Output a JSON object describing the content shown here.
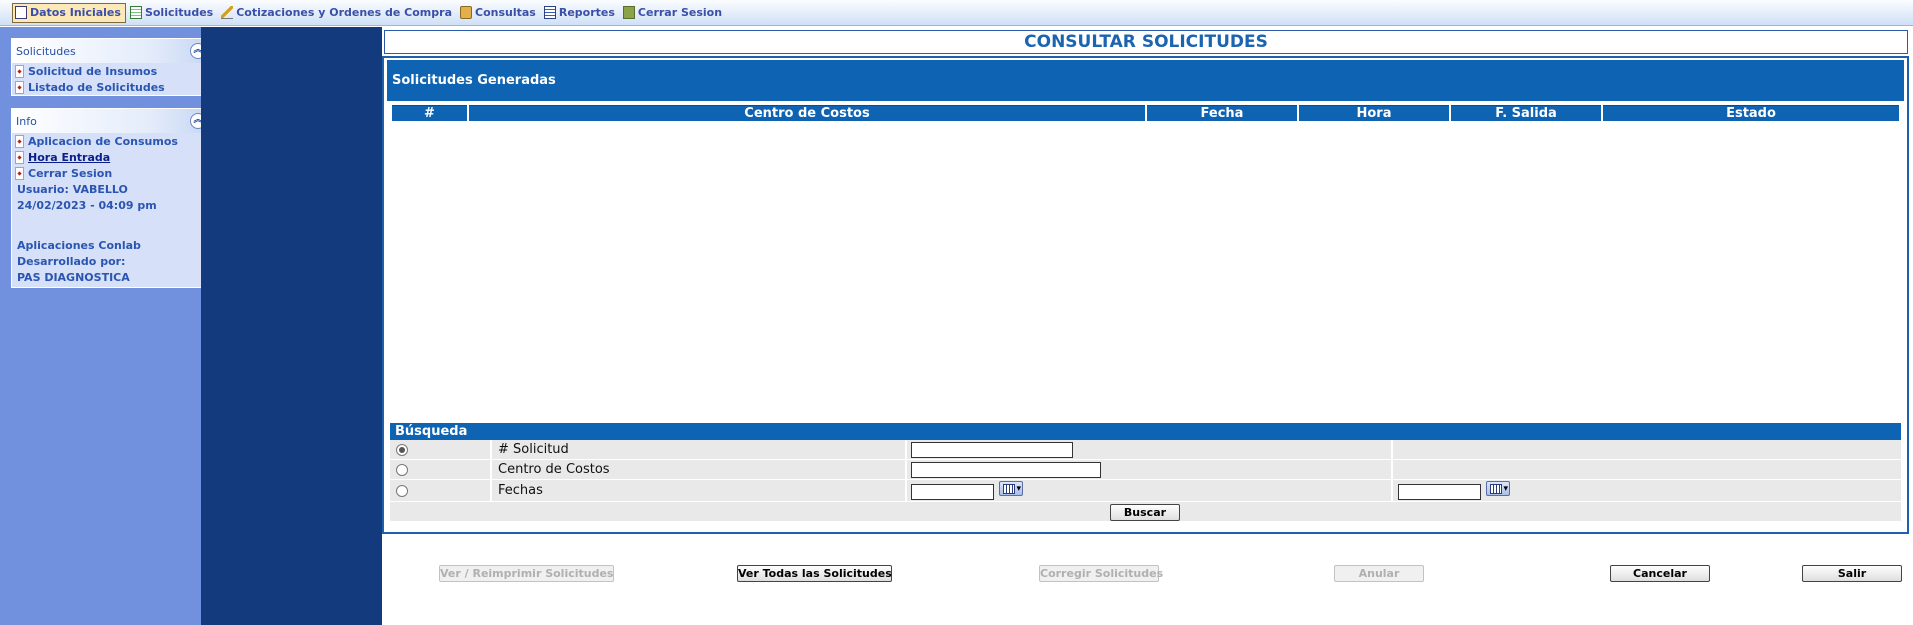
{
  "menu": {
    "items": [
      {
        "label": "Datos Iniciales",
        "icon": "doc-icon",
        "active": true
      },
      {
        "label": "Solicitudes",
        "icon": "sheet-icon"
      },
      {
        "label": "Cotizaciones y Ordenes de Compra",
        "icon": "pen-icon"
      },
      {
        "label": "Consultas",
        "icon": "box-icon"
      },
      {
        "label": "Reportes",
        "icon": "report-icon"
      },
      {
        "label": "Cerrar Sesion",
        "icon": "exit-icon"
      }
    ]
  },
  "sidebar": {
    "solicitudes_panel": {
      "title": "Solicitudes",
      "items": [
        "Solicitud de Insumos",
        "Listado de Solicitudes"
      ]
    },
    "info_panel": {
      "title": "Info",
      "links": [
        "Aplicacion de Consumos",
        "Hora Entrada",
        "Cerrar Sesion"
      ],
      "user": "Usuario: VABELLO",
      "datetime": "24/02/2023 - 04:09 pm",
      "credits": [
        "Aplicaciones Conlab",
        "Desarrollado por:",
        "PAS DIAGNOSTICA"
      ]
    }
  },
  "main": {
    "title": "CONSULTAR SOLICITUDES",
    "results_title": "Solicitudes Generadas",
    "columns": [
      "#",
      "Centro de Costos",
      "Fecha",
      "Hora",
      "F. Salida",
      "Estado"
    ],
    "search": {
      "title": "Búsqueda",
      "options": [
        "# Solicitud",
        "Centro de Costos",
        "Fechas"
      ],
      "selected": "# Solicitud",
      "buscar_label": "Buscar"
    },
    "actions": {
      "ver_reimprimir": "Ver / Reimprimir Solicitudes",
      "ver_todas": "Ver Todas las Solicitudes",
      "corregir": "Corregir Solicitudes",
      "anular": "Anular",
      "cancelar": "Cancelar",
      "salir": "Salir"
    }
  },
  "colors": {
    "accent_blue": "#0e63b3",
    "sidebar_bg": "#7191df",
    "dark_band": "#143a7e",
    "title_text": "#1b64b0"
  }
}
